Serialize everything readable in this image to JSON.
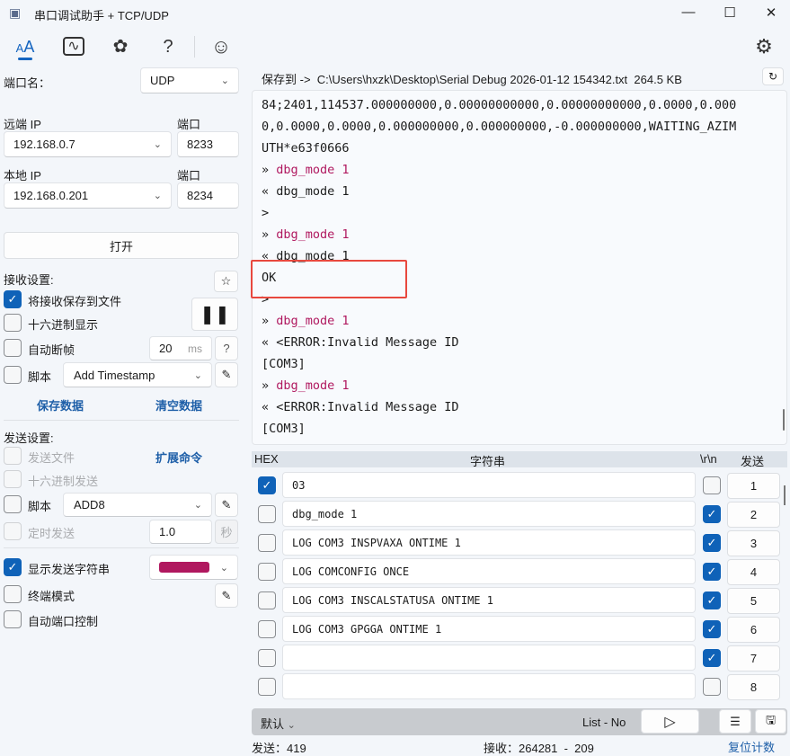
{
  "window": {
    "title": "串口调试助手 + TCP/UDP",
    "minimize": "—",
    "maximize": "☐",
    "close": "✕"
  },
  "toolbar": {
    "font_icon": "A",
    "help": "?"
  },
  "port": {
    "name_label": "端口名：",
    "name_value": "UDP",
    "remote_ip_label": "远端 IP",
    "remote_ip": "192.168.0.7",
    "remote_port_label": "端口",
    "remote_port": "8233",
    "local_ip_label": "本地 IP",
    "local_ip": "192.168.0.201",
    "local_port_label": "端口",
    "local_port": "8234",
    "open_button": "打开"
  },
  "receive": {
    "title": "接收设置:",
    "save_to_file": "将接收保存到文件",
    "hex_display": "十六进制显示",
    "auto_frame": "自动断帧",
    "frame_ms": "20",
    "ms_unit": "ms",
    "help": "?",
    "script": "脚本",
    "script_value": "Add Timestamp",
    "save_data": "保存数据",
    "clear_data": "清空数据",
    "pause": "❚❚"
  },
  "send": {
    "title": "发送设置:",
    "send_file": "发送文件",
    "ext_cmd": "扩展命令",
    "hex_send": "十六进制发送",
    "script": "脚本",
    "script_value": "ADD8",
    "timed_send": "定时发送",
    "interval": "1.0",
    "sec_unit": "秒",
    "show_send": "显示发送字符串",
    "send_color": "#b0185f",
    "terminal_mode": "终端模式",
    "auto_port": "自动端口控制"
  },
  "save_path": {
    "label": "保存到 ->  C:\\Users\\hxzk\\Desktop\\Serial Debug 2026-01-12 154342.txt  264.5 KB"
  },
  "log": [
    {
      "p": "",
      "t": "84;2401,114537.000000000,0.00000000000,0.00000000000,0.0000,0.000",
      "tx": false
    },
    {
      "p": "",
      "t": "0,0.0000,0.0000,0.000000000,0.000000000,-0.000000000,WAITING_AZIM",
      "tx": false
    },
    {
      "p": "",
      "t": "UTH*e63f0666",
      "tx": false
    },
    {
      "p": "» ",
      "t": "dbg_mode 1",
      "tx": true
    },
    {
      "p": "« ",
      "t": "dbg_mode 1",
      "tx": false
    },
    {
      "p": "",
      "t": ">",
      "tx": false
    },
    {
      "p": "» ",
      "t": "dbg_mode 1",
      "tx": true
    },
    {
      "p": "« ",
      "t": "dbg_mode 1",
      "tx": false
    },
    {
      "p": "",
      "t": "OK",
      "tx": false
    },
    {
      "p": "",
      "t": ">",
      "tx": false
    },
    {
      "p": "» ",
      "t": "dbg_mode 1",
      "tx": true
    },
    {
      "p": "« ",
      "t": "<ERROR:Invalid Message ID",
      "tx": false
    },
    {
      "p": "",
      "t": "[COM3]",
      "tx": false
    },
    {
      "p": "» ",
      "t": "dbg_mode 1",
      "tx": true
    },
    {
      "p": "« ",
      "t": "<ERROR:Invalid Message ID",
      "tx": false
    },
    {
      "p": "",
      "t": "[COM3]",
      "tx": false
    }
  ],
  "table": {
    "hex_header": "HEX",
    "string_header": "字符串",
    "crlf_header": "\\r\\n",
    "send_header": "发送",
    "rows": [
      {
        "hex": true,
        "text": "03",
        "crlf": false,
        "n": "1"
      },
      {
        "hex": false,
        "text": "dbg_mode 1",
        "crlf": true,
        "n": "2"
      },
      {
        "hex": false,
        "text": "LOG COM3 INSPVAXA ONTIME 1",
        "crlf": true,
        "n": "3"
      },
      {
        "hex": false,
        "text": "LOG COMCONFIG ONCE",
        "crlf": true,
        "n": "4"
      },
      {
        "hex": false,
        "text": "LOG COM3 INSCALSTATUSA ONTIME 1",
        "crlf": true,
        "n": "5"
      },
      {
        "hex": false,
        "text": "LOG COM3 GPGGA ONTIME 1",
        "crlf": true,
        "n": "6"
      },
      {
        "hex": false,
        "text": "",
        "crlf": true,
        "n": "7"
      },
      {
        "hex": false,
        "text": "",
        "crlf": false,
        "n": "8"
      }
    ]
  },
  "bottom": {
    "preset": "默认",
    "list_status": "List - No"
  },
  "status": {
    "sent": "发送：419",
    "received": "接收：264281  -  209",
    "reset": "复位计数"
  }
}
